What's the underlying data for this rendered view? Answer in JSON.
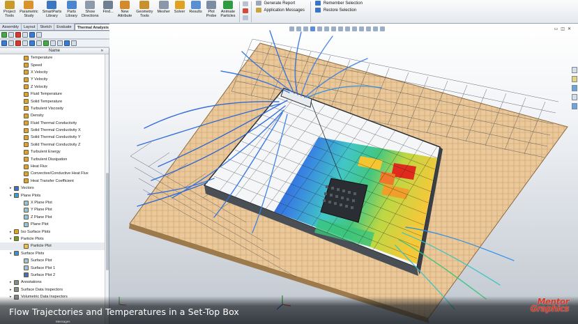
{
  "ribbon": {
    "buttons": [
      {
        "label": "Project\nTools",
        "color": "#c99a28"
      },
      {
        "label": "Parametric\nStudy",
        "color": "#d9932a"
      },
      {
        "label": "SmartParts\nLibrary",
        "color": "#3b76c4"
      },
      {
        "label": "Parts\nLibrary",
        "color": "#4a86cf"
      },
      {
        "label": "Show\nDirections",
        "color": "#8c9aab"
      },
      {
        "label": "Find...",
        "color": "#6f7f92"
      },
      {
        "label": "New\nAttribute",
        "color": "#d48a2a"
      },
      {
        "label": "Geometry\nTools",
        "color": "#c9902e"
      },
      {
        "label": "Mesher",
        "color": "#8a97a8"
      },
      {
        "label": "Solver",
        "color": "#e0a020"
      },
      {
        "label": "Results",
        "color": "#5a8fd3"
      },
      {
        "label": "Plot\nProbe",
        "color": "#7a8da3"
      },
      {
        "label": "Animate\nParticles",
        "color": "#2f9d3f"
      }
    ],
    "reports": [
      "Generate Report",
      "Application Messages"
    ],
    "selection": [
      "Remember Selection",
      "Restore Selection"
    ]
  },
  "tabs": [
    {
      "label": "Assembly",
      "active": false
    },
    {
      "label": "Layout",
      "active": false
    },
    {
      "label": "Sketch",
      "active": false
    },
    {
      "label": "Evaluate",
      "active": false
    },
    {
      "label": "Thermal Analysis",
      "active": true
    }
  ],
  "tree": {
    "column_header": "Name",
    "items": [
      {
        "label": "Temperature",
        "indent": 2,
        "icon": "#d9a23a"
      },
      {
        "label": "Speed",
        "indent": 2,
        "icon": "#d9a23a"
      },
      {
        "label": "X Velocity",
        "indent": 2,
        "icon": "#d9a23a"
      },
      {
        "label": "Y Velocity",
        "indent": 2,
        "icon": "#d9a23a"
      },
      {
        "label": "Z Velocity",
        "indent": 2,
        "icon": "#d9a23a"
      },
      {
        "label": "Fluid Temperature",
        "indent": 2,
        "icon": "#d9a23a"
      },
      {
        "label": "Solid Temperature",
        "indent": 2,
        "icon": "#d9a23a"
      },
      {
        "label": "Turbulent Viscosity",
        "indent": 2,
        "icon": "#d9a23a"
      },
      {
        "label": "Density",
        "indent": 2,
        "icon": "#d9a23a"
      },
      {
        "label": "Fluid Thermal Conductivity",
        "indent": 2,
        "icon": "#d9a23a"
      },
      {
        "label": "Solid Thermal Conductivity X",
        "indent": 2,
        "icon": "#d9a23a"
      },
      {
        "label": "Solid Thermal Conductivity Y",
        "indent": 2,
        "icon": "#d9a23a"
      },
      {
        "label": "Solid Thermal Conductivity Z",
        "indent": 2,
        "icon": "#d9a23a"
      },
      {
        "label": "Turbulent Energy",
        "indent": 2,
        "icon": "#d9a23a"
      },
      {
        "label": "Turbulent Dissipation",
        "indent": 2,
        "icon": "#d9a23a"
      },
      {
        "label": "Heat Flux",
        "indent": 2,
        "icon": "#d9a23a"
      },
      {
        "label": "Convective/Conductive Heat Flux",
        "indent": 2,
        "icon": "#d9a23a"
      },
      {
        "label": "Heat Transfer Coefficient",
        "indent": 2,
        "icon": "#d9a23a"
      },
      {
        "label": "Vectors",
        "indent": 1,
        "icon": "#3a6fcf",
        "toggle": "▸"
      },
      {
        "label": "Plane Plots",
        "indent": 1,
        "icon": "#3a9bd6",
        "toggle": "▾"
      },
      {
        "label": "X Plane Plot",
        "indent": 2,
        "icon": "#8fc4e8"
      },
      {
        "label": "Y Plane Plot",
        "indent": 2,
        "icon": "#8fc4e8"
      },
      {
        "label": "Z Plane Plot",
        "indent": 2,
        "icon": "#8fc4e8"
      },
      {
        "label": "Plane Plot",
        "indent": 2,
        "icon": "#8fc4e8"
      },
      {
        "label": "Iso Surface Plots",
        "indent": 1,
        "icon": "#d9a23a",
        "toggle": "▸"
      },
      {
        "label": "Particle Plots",
        "indent": 1,
        "icon": "#6a9b3a",
        "toggle": "▾"
      },
      {
        "label": "Particle Plot",
        "indent": 2,
        "icon": "#e5c35a",
        "selected": true
      },
      {
        "label": "Surface Plots",
        "indent": 1,
        "icon": "#3a8fd6",
        "toggle": "▾"
      },
      {
        "label": "Surface Plot",
        "indent": 2,
        "icon": "#9cc3e6"
      },
      {
        "label": "Surface Plot 1",
        "indent": 2,
        "icon": "#9cc3e6"
      },
      {
        "label": "Surface Plot 2",
        "indent": 2,
        "icon": "#4a6fb8"
      },
      {
        "label": "Annotations",
        "indent": 1,
        "icon": "#7a8da3",
        "toggle": "▸"
      },
      {
        "label": "Surface Data Inspectors",
        "indent": 1,
        "icon": "#7a8da3",
        "toggle": "▸"
      },
      {
        "label": "Volumetric Data Inspectors",
        "indent": 1,
        "icon": "#7a8da3",
        "toggle": "▸"
      }
    ]
  },
  "status_bar": {
    "messages_label": "Messages"
  },
  "caption": "Flow Trajectories and Temperatures in a Set-Top Box",
  "logo": {
    "line1": "Mentor",
    "line2": "Graphics"
  },
  "colors": {
    "board": "#e8c590",
    "hot": "#e02a1e",
    "warm": "#f5c630",
    "mild": "#39c47a",
    "cool": "#2f7fe0",
    "cold": "#1d3fd0"
  }
}
